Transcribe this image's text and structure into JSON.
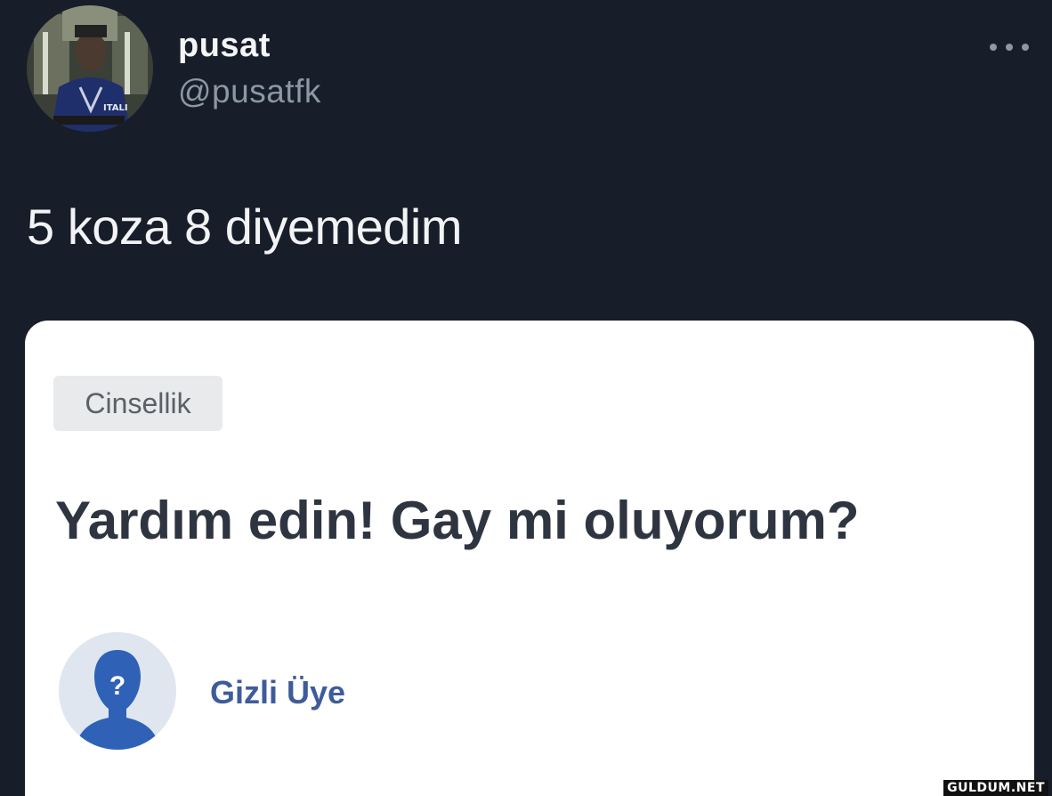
{
  "tweet": {
    "display_name": "pusat",
    "handle": "@pusatfk",
    "text": "5 koza 8 diyemedim",
    "more_icon": "more-horizontal-icon"
  },
  "card": {
    "category": "Cinsellik",
    "question_title": "Yardım edin! Gay mi oluyorum?",
    "user_name": "Gizli Üye",
    "user_avatar_icon": "anonymous-user-icon",
    "avatar_symbol": "?"
  },
  "watermark": "GULDUM.NET",
  "colors": {
    "background": "#171d29",
    "card": "#ffffff",
    "user_name": "#3f5c9a",
    "avatar_figure": "#2f62b6"
  }
}
